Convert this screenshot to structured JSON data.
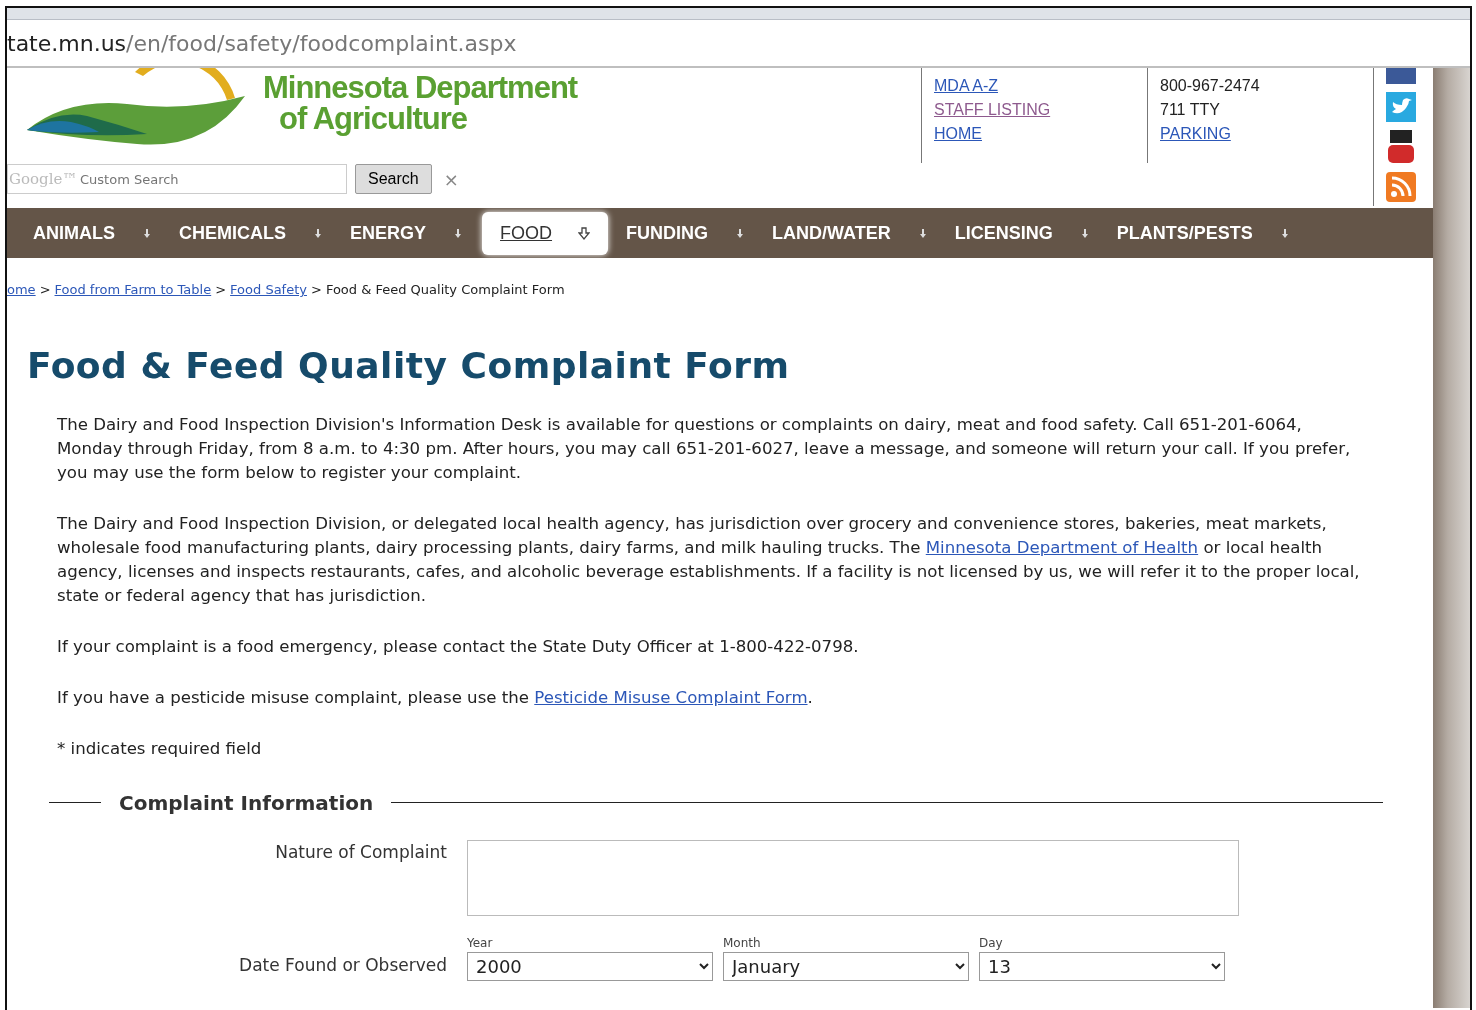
{
  "browser": {
    "url_host": "tate.mn.us",
    "url_path": "/en/food/safety/foodcomplaint.aspx"
  },
  "header": {
    "logo_line_1": "Minnesota Department",
    "logo_line_2": "of Agriculture",
    "search": {
      "brand": "Google™",
      "placeholder": "Custom Search",
      "button": "Search",
      "clear": "×"
    },
    "links": [
      {
        "label": "MDA A-Z",
        "visited": false
      },
      {
        "label": "STAFF LISTING",
        "visited": true
      },
      {
        "label": "HOME",
        "visited": false
      }
    ],
    "contact": [
      {
        "kind": "text",
        "label": "800-967-2474"
      },
      {
        "kind": "text",
        "label": "711 TTY"
      },
      {
        "kind": "link",
        "label": "PARKING"
      }
    ]
  },
  "nav": [
    {
      "label": "ANIMALS",
      "selected": false
    },
    {
      "label": "CHEMICALS",
      "selected": false
    },
    {
      "label": "ENERGY",
      "selected": false
    },
    {
      "label": "FOOD",
      "selected": true
    },
    {
      "label": "FUNDING",
      "selected": false
    },
    {
      "label": "LAND/WATER",
      "selected": false
    },
    {
      "label": "LICENSING",
      "selected": false
    },
    {
      "label": "PLANTS/PESTS",
      "selected": false
    }
  ],
  "breadcrumb": [
    {
      "label": "ome",
      "kind": "link"
    },
    {
      "label": "Food from Farm to Table",
      "kind": "link"
    },
    {
      "label": "Food Safety",
      "kind": "link"
    },
    {
      "label": "Food & Feed Quality Complaint Form",
      "kind": "current"
    }
  ],
  "breadcrumb_separator": ">",
  "title": "Food & Feed Quality Complaint Form",
  "paragraphs": [
    [
      {
        "kind": "text",
        "text": "The Dairy and Food Inspection Division's Information Desk is available for questions or complaints on dairy, meat and food safety. Call 651-201-6064, Monday through Friday, from 8 a.m. to 4:30 pm. After hours, you may call 651-201-6027, leave a message, and someone will return your call. If you prefer, you may use the form below to register your complaint."
      }
    ],
    [
      {
        "kind": "text",
        "text": "The Dairy and Food Inspection Division, or delegated local health agency, has jurisdiction over grocery and convenience stores, bakeries, meat markets, wholesale food manufacturing plants, dairy processing plants, dairy farms, and milk hauling trucks. The "
      },
      {
        "kind": "link",
        "text": "Minnesota Department of Health"
      },
      {
        "kind": "text",
        "text": " or local health agency, licenses and inspects restaurants, cafes, and alcoholic beverage establishments. If a facility is not licensed by us, we will refer it to the proper local, state or federal agency that has jurisdiction."
      }
    ],
    [
      {
        "kind": "text",
        "text": "If your complaint is a food emergency, please contact the State Duty Officer at 1-800-422-0798."
      }
    ],
    [
      {
        "kind": "text",
        "text": "If you have a pesticide misuse complaint, please use the "
      },
      {
        "kind": "link",
        "text": "Pesticide Misuse Complaint Form"
      },
      {
        "kind": "text",
        "text": "."
      }
    ],
    [
      {
        "kind": "text",
        "text": "* indicates required field"
      }
    ]
  ],
  "form": {
    "legend": "Complaint Information",
    "nature_label": "Nature of Complaint",
    "date_label": "Date Found or Observed",
    "date_fields": [
      {
        "label": "Year",
        "value": "2000"
      },
      {
        "label": "Month",
        "value": "January"
      },
      {
        "label": "Day",
        "value": "13"
      }
    ]
  }
}
